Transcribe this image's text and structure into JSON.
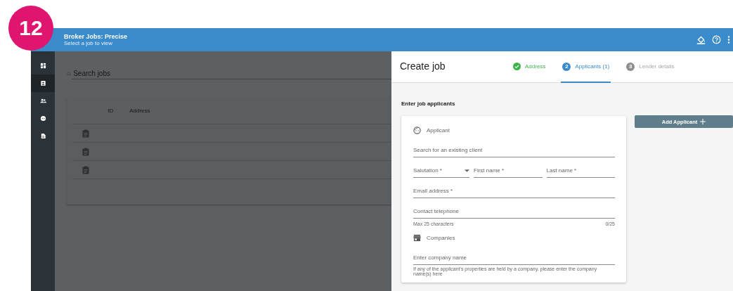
{
  "badge": "12",
  "app_bar": {
    "title": "Broker Jobs: Precise",
    "subtitle": "Select a job to view"
  },
  "sidebar": {
    "items": [
      {
        "selected": false
      },
      {
        "selected": true
      },
      {
        "selected": false
      },
      {
        "selected": false
      },
      {
        "selected": false
      }
    ]
  },
  "jobs": {
    "search_placeholder": "Search jobs",
    "columns": [
      "ID",
      "Address"
    ],
    "rows": [
      {
        "kind": "job"
      },
      {
        "kind": "job"
      },
      {
        "kind": "job"
      }
    ]
  },
  "drawer": {
    "title": "Create job",
    "steps": [
      {
        "label": "Address",
        "completed": true,
        "disabled": false,
        "selected": false
      },
      {
        "number": "2",
        "label": "Applicants (1)",
        "completed": false,
        "disabled": false,
        "selected": true
      },
      {
        "number": "3",
        "label": "Lender details",
        "completed": false,
        "disabled": true,
        "selected": false
      }
    ],
    "section_title": "Enter job applicants",
    "add_button": "Add Applicant",
    "applicant": {
      "heading": "Applicant",
      "search_placeholder": "Search for an existing client",
      "name_fields": [
        {
          "kind": "select",
          "placeholder": "Salutation *"
        },
        {
          "kind": "text",
          "placeholder": "First name *"
        },
        {
          "kind": "text",
          "placeholder": "Last name *"
        }
      ],
      "email_placeholder": "Email address *",
      "phone_placeholder": "Contact telephone",
      "phone_hint": "Max 25 characters",
      "phone_counter": "0/25"
    },
    "companies": {
      "heading": "Companies",
      "placeholder": "Enter company name",
      "hint": "If any of the applicant's properties are held by a company, please enter the company name(s) here"
    }
  }
}
